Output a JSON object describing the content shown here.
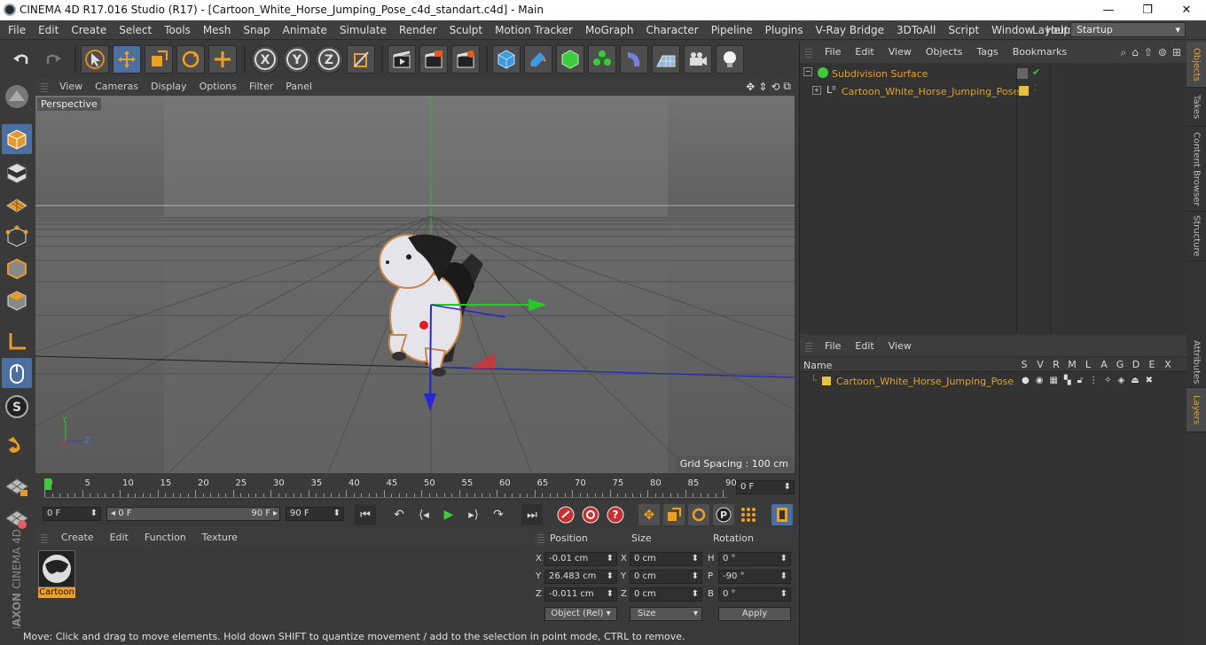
{
  "window": {
    "title": "CINEMA 4D R17.016 Studio (R17) - [Cartoon_White_Horse_Jumping_Pose_c4d_standart.c4d] - Main",
    "min": "—",
    "max": "❐",
    "close": "✕"
  },
  "menubar": {
    "items": [
      "File",
      "Edit",
      "Create",
      "Select",
      "Tools",
      "Mesh",
      "Snap",
      "Animate",
      "Simulate",
      "Render",
      "Sculpt",
      "Motion Tracker",
      "MoGraph",
      "Character",
      "Pipeline",
      "Plugins",
      "V-Ray Bridge",
      "3DToAll",
      "Script",
      "Window",
      "Help"
    ],
    "layout_label": "Layout:",
    "layout_value": "Startup"
  },
  "viewport": {
    "menu": [
      "View",
      "Cameras",
      "Display",
      "Options",
      "Filter",
      "Panel"
    ],
    "camera_label": "Perspective",
    "grid_spacing": "Grid Spacing : 100 cm",
    "axis_x": "Z",
    "axis_y": "Y"
  },
  "timeline": {
    "ticks": [
      "0",
      "5",
      "10",
      "15",
      "20",
      "25",
      "30",
      "35",
      "40",
      "45",
      "50",
      "55",
      "60",
      "65",
      "70",
      "75",
      "80",
      "85",
      "90"
    ],
    "current_frame": "0 F"
  },
  "transport": {
    "start": "0 F",
    "range_start": "0 F",
    "range_end": "90 F",
    "end": "90 F"
  },
  "materials": {
    "menu": [
      "Create",
      "Edit",
      "Function",
      "Texture"
    ],
    "items": [
      {
        "label": "Cartoon"
      }
    ]
  },
  "coordinates": {
    "headers": {
      "position": "Position",
      "size": "Size",
      "rotation": "Rotation"
    },
    "rows": [
      {
        "axis": "X",
        "pos": "-0.01 cm",
        "size_axis": "X",
        "size": "0 cm",
        "rot_axis": "H",
        "rot": "0 °"
      },
      {
        "axis": "Y",
        "pos": "26.483 cm",
        "size_axis": "Y",
        "size": "0 cm",
        "rot_axis": "P",
        "rot": "-90 °"
      },
      {
        "axis": "Z",
        "pos": "-0.011 cm",
        "size_axis": "Z",
        "size": "0 cm",
        "rot_axis": "B",
        "rot": "0 °"
      }
    ],
    "mode": "Object (Rel)",
    "size_mode": "Size",
    "apply": "Apply"
  },
  "status": "Move: Click and drag to move elements. Hold down SHIFT to quantize movement / add to the selection in point mode, CTRL to remove.",
  "objects_panel": {
    "menu": [
      "File",
      "Edit",
      "View",
      "Objects",
      "Tags",
      "Bookmarks"
    ],
    "tree": [
      {
        "name": "Subdivision Surface"
      },
      {
        "name": "Cartoon_White_Horse_Jumping_Pose"
      }
    ]
  },
  "layers_panel": {
    "menu": [
      "File",
      "Edit",
      "View"
    ],
    "name_header": "Name",
    "columns": [
      "S",
      "V",
      "R",
      "M",
      "L",
      "A",
      "G",
      "D",
      "E",
      "X"
    ],
    "row": "Cartoon_White_Horse_Jumping_Pose",
    "layer_color": "#e8c23a"
  },
  "side_tabs": [
    "Objects",
    "Takes",
    "Content Browser",
    "Structure",
    "Attributes",
    "Layers"
  ],
  "colors": {
    "accent_orange": "#e0a32e",
    "selected_blue": "#4b6f9e",
    "object_green": "#4ccf3a"
  }
}
